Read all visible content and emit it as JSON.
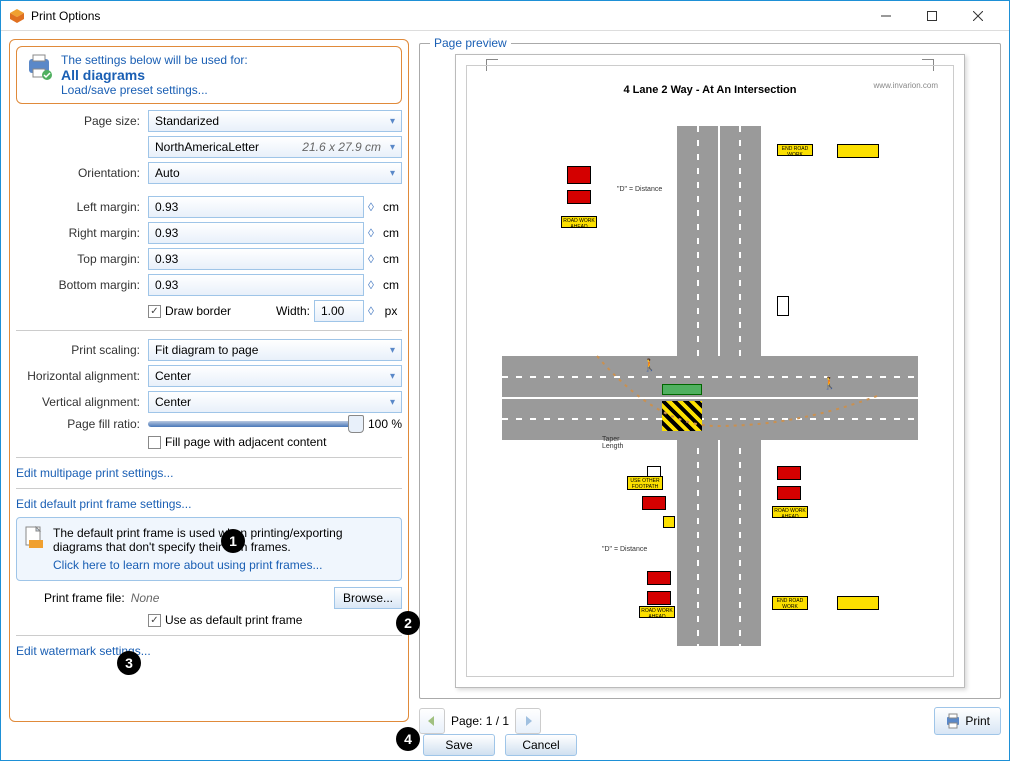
{
  "window": {
    "title": "Print Options"
  },
  "header": {
    "line1": "The settings below will be used for:",
    "line2": "All diagrams",
    "load_save_link": "Load/save preset settings..."
  },
  "page": {
    "size_label": "Page size:",
    "size_value": "Standarized",
    "format_value": "NorthAmericaLetter",
    "dims": "21.6 x 27.9 cm",
    "orientation_label": "Orientation:",
    "orientation_value": "Auto"
  },
  "margins": {
    "left_label": "Left margin:",
    "left_value": "0.93",
    "right_label": "Right margin:",
    "right_value": "0.93",
    "top_label": "Top margin:",
    "top_value": "0.93",
    "bottom_label": "Bottom margin:",
    "bottom_value": "0.93",
    "unit": "cm",
    "draw_border_label": "Draw border",
    "width_label": "Width:",
    "width_value": "1.00",
    "width_unit": "px"
  },
  "scaling": {
    "print_scaling_label": "Print scaling:",
    "print_scaling_value": "Fit diagram to page",
    "halign_label": "Horizontal alignment:",
    "halign_value": "Center",
    "valign_label": "Vertical alignment:",
    "valign_value": "Center",
    "fill_ratio_label": "Page fill ratio:",
    "fill_ratio_value": "100 %",
    "fill_adjacent_label": "Fill page with adjacent content"
  },
  "links": {
    "multipage": "Edit multipage print settings...",
    "default_frame": "Edit default print frame settings...",
    "watermark": "Edit watermark settings..."
  },
  "frame": {
    "info_text": "The default print frame is used when printing/exporting diagrams that don't specify their own frames.",
    "learn_more": "Click here to learn more about using print frames...",
    "file_label": "Print frame file:",
    "file_value": "None",
    "browse": "Browse...",
    "use_default_label": "Use as default print frame"
  },
  "preview": {
    "legend": "Page preview",
    "diagram_title": "4 Lane 2 Way - At An Intersection",
    "watermark": "www.invarion.com",
    "page_label": "Page: 1 / 1",
    "print_btn": "Print"
  },
  "buttons": {
    "save": "Save",
    "cancel": "Cancel"
  },
  "markers": {
    "m1": "1",
    "m2": "2",
    "m3": "3",
    "m4": "4"
  }
}
